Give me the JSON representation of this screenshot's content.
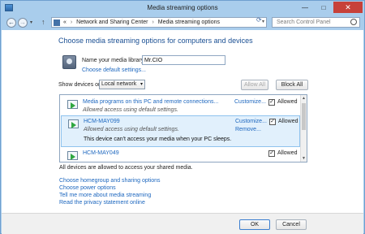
{
  "window": {
    "title": "Media streaming options",
    "controls": {
      "minimize": "—",
      "maximize": "□",
      "close": "✕"
    }
  },
  "navigation": {
    "back_icon": "←",
    "forward_icon": "→",
    "dropdown_icon": "▾",
    "up_icon": "↑",
    "address": {
      "prefix": "«",
      "crumbs": [
        "Network and Sharing Center",
        "Media streaming options"
      ],
      "separator": "›",
      "dropdown_icon": "▾"
    },
    "refresh_icon": "⟳",
    "search_placeholder": "Search Control Panel"
  },
  "main": {
    "heading": "Choose media streaming options for computers and devices",
    "library": {
      "label": "Name your media library:",
      "value": "Mr.CIO",
      "default_link": "Choose default settings..."
    },
    "filter": {
      "label": "Show devices on:",
      "selected": "Local network",
      "caret": "▾"
    },
    "buttons": {
      "allow_all": "Allow All",
      "block_all": "Block All"
    },
    "devices": [
      {
        "name": "Media programs on this PC and remote connections...",
        "status": "Allowed access using default settings.",
        "action": "Customize...",
        "allowed_label": "Allowed",
        "checked": true
      },
      {
        "name": "HCM-MAY099",
        "status": "Allowed access using default settings.",
        "warning": "This device can't access your media when your PC sleeps.",
        "action": "Customize...",
        "secondary_action": "Remove...",
        "allowed_label": "Allowed",
        "checked": true
      },
      {
        "name": "HCM-MAY049",
        "allowed_label": "Allowed",
        "checked": true
      }
    ],
    "scroll_icons": {
      "up": "▲",
      "down": "▼"
    },
    "summary": "All devices are allowed to access your shared media.",
    "links": [
      "Choose homegroup and sharing options",
      "Choose power options",
      "Tell me more about media streaming",
      "Read the privacy statement online"
    ]
  },
  "footer": {
    "ok": "OK",
    "cancel": "Cancel"
  },
  "colors": {
    "heading": "#1a4f93",
    "link": "#1d67bf",
    "selected_row": "#e1f0fc",
    "close_button": "#c7413a"
  },
  "icons": [
    "window-icon",
    "back-arrow-icon",
    "forward-arrow-icon",
    "up-arrow-icon",
    "control-panel-icon",
    "search-icon",
    "media-library-icon",
    "device-play-icon",
    "checkbox-check-icon"
  ]
}
